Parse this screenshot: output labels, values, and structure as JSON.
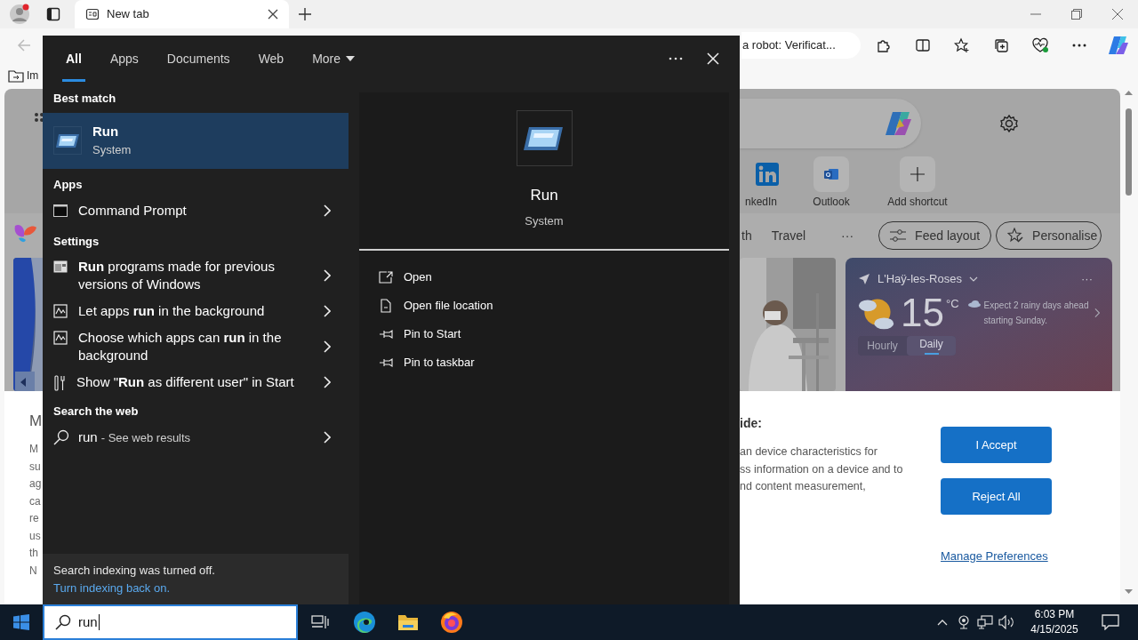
{
  "browser": {
    "tabs": [
      {
        "title": "New tab",
        "selected": true
      }
    ],
    "address_bar": {
      "value": "a robot: Verificat..."
    },
    "favorites": [
      {
        "label": "Im"
      }
    ],
    "shortcuts": [
      {
        "label": "nkedIn"
      },
      {
        "label": "Outlook"
      },
      {
        "label": "Add shortcut"
      }
    ],
    "feed_tabs": [
      {
        "label": "th"
      },
      {
        "label": "Travel"
      },
      {
        "label": "···"
      }
    ],
    "feed_buttons": [
      {
        "label": "Feed layout"
      },
      {
        "label": "Personalise"
      }
    ],
    "weather": {
      "location": "L'Haÿ-les-Roses",
      "more": "···",
      "temperature": "15",
      "unit": "°C",
      "forecast": "Expect 2 rainy days ahead starting Sunday.",
      "views": [
        {
          "label": "Hourly",
          "selected": false
        },
        {
          "label": "Daily",
          "selected": true
        }
      ]
    },
    "consent": {
      "heading_fragment": "M",
      "body_fragments": [
        "M",
        "su",
        "ag",
        "ca",
        "re",
        "us",
        "th",
        "N"
      ],
      "subheading": "ide:",
      "text_lines": [
        "an device characteristics for",
        "ss information on a device and to",
        "nd content measurement,"
      ],
      "buttons": [
        {
          "label": "I Accept"
        },
        {
          "label": "Reject All"
        }
      ],
      "link": "Manage Preferences"
    }
  },
  "search_panel": {
    "tabs": [
      {
        "label": "All",
        "selected": true,
        "dropdown": false
      },
      {
        "label": "Apps",
        "selected": false,
        "dropdown": false
      },
      {
        "label": "Documents",
        "selected": false,
        "dropdown": false
      },
      {
        "label": "Web",
        "selected": false,
        "dropdown": false
      },
      {
        "label": "More",
        "selected": false,
        "dropdown": true
      }
    ],
    "sections": [
      {
        "heading": "Best match",
        "items": [
          {
            "kind": "best",
            "title": "Run",
            "subtitle": "System",
            "selected": true
          }
        ]
      },
      {
        "heading": "Apps",
        "items": [
          {
            "kind": "app",
            "text": "Command Prompt",
            "selected": false
          }
        ]
      },
      {
        "heading": "Settings",
        "items": [
          {
            "kind": "setting",
            "text": "**Run** programs made for previous versions of Windows",
            "selected": false
          },
          {
            "kind": "setting",
            "text": "Let apps **run** in the background",
            "selected": false
          },
          {
            "kind": "setting",
            "text": "Choose which apps can **run** in the background",
            "selected": false
          },
          {
            "kind": "setting",
            "text": "Show \"**Run** as different user\" in Start",
            "selected": false
          }
        ]
      },
      {
        "heading": "Search the web",
        "items": [
          {
            "kind": "web",
            "query": "run",
            "suffix": "- See web results",
            "selected": false
          }
        ]
      }
    ],
    "footer": {
      "message": "Search indexing was turned off.",
      "link": "Turn indexing back on."
    },
    "preview": {
      "title": "Run",
      "subtitle": "System",
      "actions": [
        {
          "label": "Open"
        },
        {
          "label": "Open file location"
        },
        {
          "label": "Pin to Start"
        },
        {
          "label": "Pin to taskbar"
        }
      ]
    }
  },
  "taskbar": {
    "search": {
      "value": "run"
    },
    "clock": {
      "time": "6:03 PM",
      "date": "4/15/2025"
    }
  }
}
